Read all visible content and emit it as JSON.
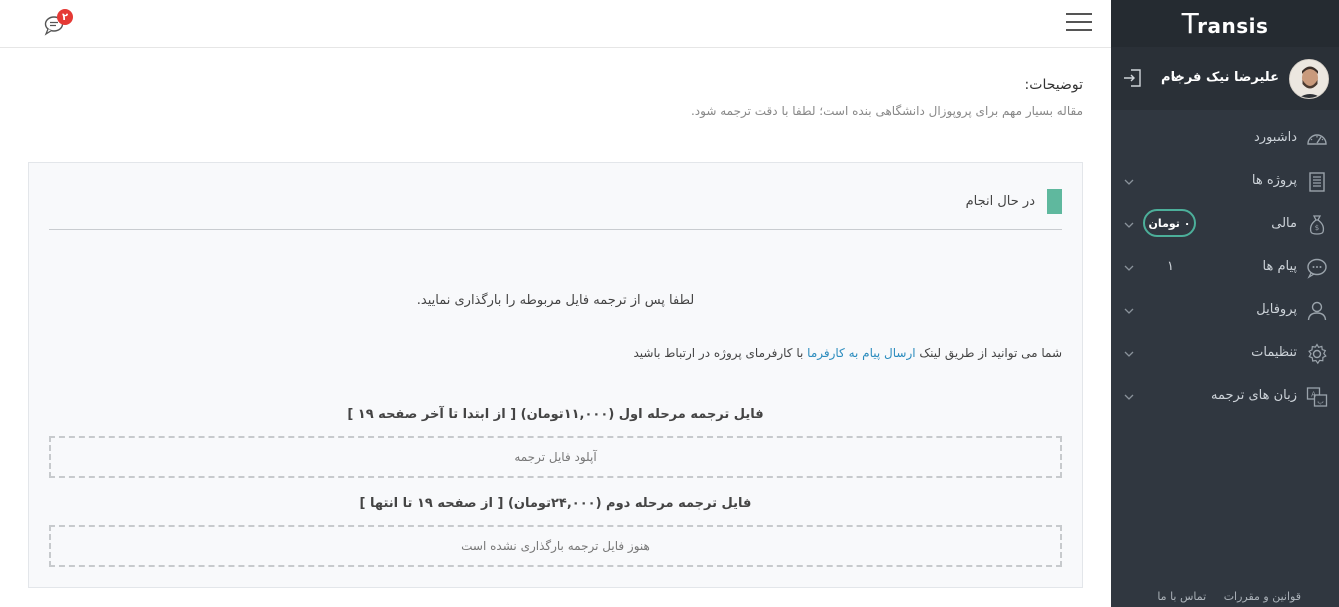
{
  "brand": {
    "logo_letter": "T",
    "logo_rest": "ransis"
  },
  "user": {
    "name": "علیرضا نیک فرجام"
  },
  "menu": [
    {
      "label": "داشبورد",
      "icon": "dashboard-icon",
      "has_chevron": false
    },
    {
      "label": "پروژه ها",
      "icon": "document-icon",
      "has_chevron": true
    },
    {
      "label": "مالی",
      "icon": "money-bag-icon",
      "has_chevron": true,
      "badge": "۰ تومان"
    },
    {
      "label": "پیام ها",
      "icon": "chat-bubbles-icon",
      "has_chevron": true,
      "count": "۱"
    },
    {
      "label": "پروفایل",
      "icon": "user-icon",
      "has_chevron": true
    },
    {
      "label": "تنظیمات",
      "icon": "gear-icon",
      "has_chevron": true
    },
    {
      "label": "زبان های ترجمه",
      "icon": "translate-icon",
      "has_chevron": true
    }
  ],
  "footer": {
    "rules": "قوانین و مقررات",
    "contact": "تماس با ما"
  },
  "topbar": {
    "notification_count": "۲"
  },
  "description": {
    "title": "توضیحات:",
    "text": "مقاله بسیار مهم برای پروپوزال دانشگاهی بنده است؛ لطفا با دقت ترجمه شود."
  },
  "panel": {
    "status": "در حال انجام",
    "notice_upload": "لطفا پس از ترجمه فایل مربوطه را بارگذاری نمایید.",
    "notice_contact_prefix": "شما می توانید از طریق لینک",
    "notice_contact_link": "ارسال پیام به کارفرما",
    "notice_contact_suffix": "با کارفرمای پروژه در ارتباط باشید",
    "stage1_title": "فایل ترجمه مرحله اول (۱۱,۰۰۰تومان) [ از ابتدا تا آخر صفحه ۱۹ ]",
    "stage1_box": "آپلود فایل ترجمه",
    "stage2_title": "فایل ترجمه مرحله دوم (۲۴,۰۰۰تومان) [ از صفحه ۱۹ تا انتها ]",
    "stage2_box": "هنوز فایل ترجمه بارگذاری نشده است"
  },
  "colors": {
    "sidebar": "#303740",
    "accent_green": "#5fb89e",
    "link_blue": "#2b8cbe",
    "badge_red": "#e53935"
  }
}
